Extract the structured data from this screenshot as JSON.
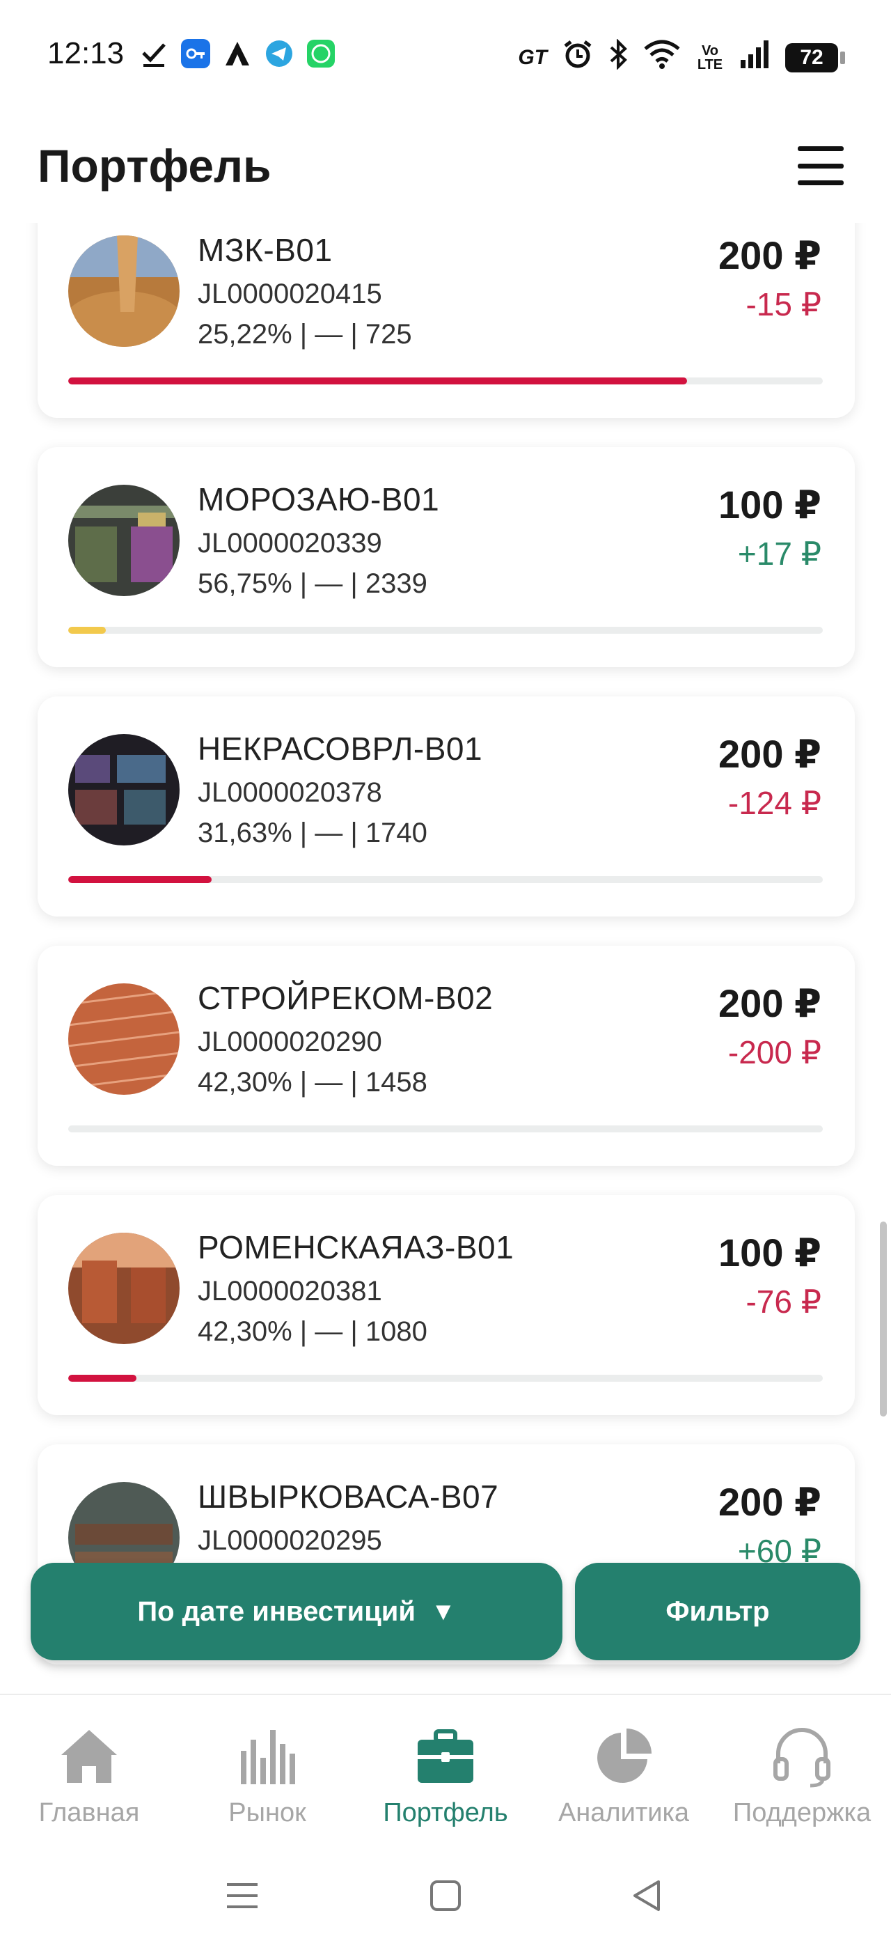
{
  "status_bar": {
    "time": "12:13",
    "battery": "72",
    "left_icons": [
      "check-icon",
      "key-icon",
      "app-a-icon",
      "telegram-icon",
      "whatsapp-icon"
    ],
    "right_icons": [
      "gt-icon",
      "alarm-icon",
      "bluetooth-icon",
      "wifi-icon",
      "volte-icon",
      "signal-icon"
    ],
    "gt_label": "GT",
    "volte_label": "Vo LTE"
  },
  "header": {
    "title": "Портфель"
  },
  "cards": [
    {
      "name": "МЗК-В01",
      "code": "JL0000020415",
      "meta": "25,22% | — | 725",
      "amount": "200 ₽",
      "delta": "-15 ₽",
      "delta_sign": "neg",
      "progress": 0.82,
      "progress_color": "#d2123f",
      "thumb": "grain"
    },
    {
      "name": "МОРОЗАЮ-В01",
      "code": "JL0000020339",
      "meta": "56,75% | — | 2339",
      "amount": "100 ₽",
      "delta": "+17 ₽",
      "delta_sign": "pos",
      "progress": 0.05,
      "progress_color": "#f2c94c",
      "thumb": "store"
    },
    {
      "name": "НЕКРАСОВРЛ-В01",
      "code": "JL0000020378",
      "meta": "31,63% | — | 1740",
      "amount": "200 ₽",
      "delta": "-124 ₽",
      "delta_sign": "neg",
      "progress": 0.19,
      "progress_color": "#d2123f",
      "thumb": "shop"
    },
    {
      "name": "СТРОЙРЕКОМ-В02",
      "code": "JL0000020290",
      "meta": "42,30% | — | 1458",
      "amount": "200 ₽",
      "delta": "-200 ₽",
      "delta_sign": "neg",
      "progress": 0.0,
      "progress_color": "#d2123f",
      "thumb": "bricks"
    },
    {
      "name": "РОМЕНСКАЯАЗ-В01",
      "code": "JL0000020381",
      "meta": "42,30% | — | 1080",
      "amount": "100 ₽",
      "delta": "-76 ₽",
      "delta_sign": "neg",
      "progress": 0.09,
      "progress_color": "#d2123f",
      "thumb": "blocks"
    },
    {
      "name": "ШВЫРКОВАСА-В07",
      "code": "JL0000020295",
      "meta": "",
      "amount": "200 ₽",
      "delta": "+60 ₽",
      "delta_sign": "pos",
      "progress": 0.0,
      "progress_color": "#d2123f",
      "thumb": "leather"
    }
  ],
  "actions": {
    "sort_label": "По дате инвестиций",
    "sort_caret": "▼",
    "filter_label": "Фильтр"
  },
  "colors": {
    "accent": "#24806e",
    "negative": "#c8294e",
    "positive": "#2a8a69"
  },
  "bottom_nav": [
    {
      "label": "Главная",
      "icon": "home-icon",
      "active": false
    },
    {
      "label": "Рынок",
      "icon": "bar-chart-icon",
      "active": false
    },
    {
      "label": "Портфель",
      "icon": "briefcase-icon",
      "active": true
    },
    {
      "label": "Аналитика",
      "icon": "pie-chart-icon",
      "active": false
    },
    {
      "label": "Поддержка",
      "icon": "headset-icon",
      "active": false
    }
  ],
  "system_nav": [
    "menu-icon",
    "home-square-icon",
    "back-icon"
  ]
}
